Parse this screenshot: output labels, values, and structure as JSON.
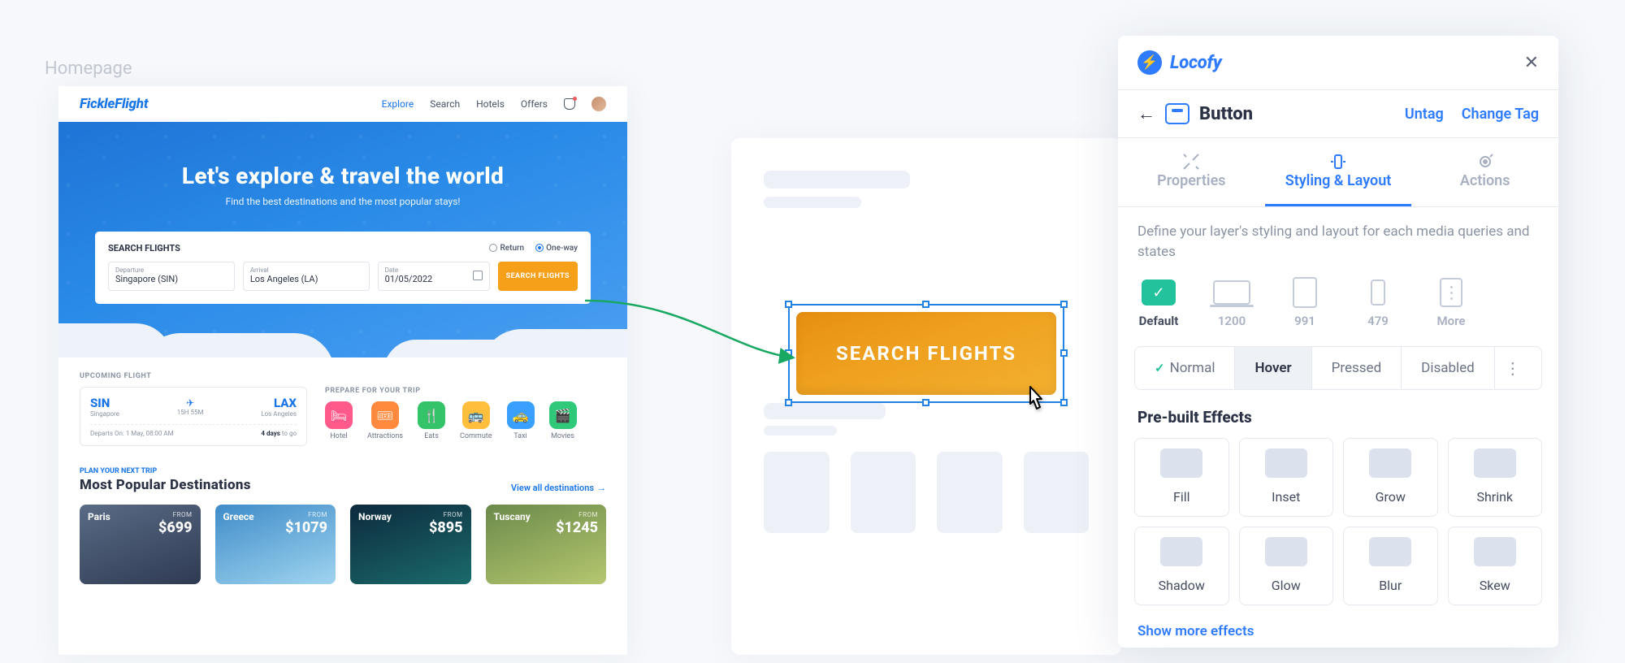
{
  "canvas": {
    "frame_label": "Homepage"
  },
  "homepage": {
    "logo": "FickleFlight",
    "nav": {
      "explore": "Explore",
      "search": "Search",
      "hotels": "Hotels",
      "offers": "Offers"
    },
    "hero": {
      "title": "Let's explore & travel the world",
      "subtitle": "Find the best destinations and the most popular stays!"
    },
    "search_card": {
      "title": "SEARCH FLIGHTS",
      "return_label": "Return",
      "oneway_label": "One-way",
      "departure_label": "Departure",
      "departure_value": "Singapore (SIN)",
      "arrival_label": "Arrival",
      "arrival_value": "Los Angeles (LA)",
      "date_label": "Date",
      "date_value": "01/05/2022",
      "button": "SEARCH FLIGHTS"
    },
    "upcoming": {
      "label": "UPCOMING FLIGHT",
      "from_code": "SIN",
      "from_city": "Singapore",
      "to_code": "LAX",
      "to_city": "Los Angeles",
      "duration": "15H 55M",
      "depart_text": "Departs On: 1 May, 08:00 AM",
      "days_num": "4 days",
      "days_suffix": " to go"
    },
    "prep": {
      "label": "PREPARE FOR YOUR TRIP",
      "items": [
        {
          "name": "Hotel",
          "color": "#ff5a8a",
          "glyph": "🛏"
        },
        {
          "name": "Attractions",
          "color": "#ff8a3d",
          "glyph": "🎟"
        },
        {
          "name": "Eats",
          "color": "#35c36a",
          "glyph": "🍴"
        },
        {
          "name": "Commute",
          "color": "#ffbf3d",
          "glyph": "🚌"
        },
        {
          "name": "Taxi",
          "color": "#39a0ff",
          "glyph": "🚕"
        },
        {
          "name": "Movies",
          "color": "#30c97a",
          "glyph": "🎬"
        }
      ]
    },
    "destinations": {
      "small": "PLAN YOUR NEXT TRIP",
      "title": "Most Popular Destinations",
      "view_all": "View all destinations",
      "from_label": "FROM",
      "cards": [
        {
          "name": "Paris",
          "price": "$699",
          "bg": "linear-gradient(160deg,#5a6b85,#2e3a52)"
        },
        {
          "name": "Greece",
          "price": "$1079",
          "bg": "linear-gradient(160deg,#3f8cc9,#9fd4ef)"
        },
        {
          "name": "Norway",
          "price": "$895",
          "bg": "linear-gradient(160deg,#0d2a3d,#1a6b6b)"
        },
        {
          "name": "Tuscany",
          "price": "$1245",
          "bg": "linear-gradient(160deg,#6b8a4a,#b5c76f)"
        }
      ]
    }
  },
  "preview_button": {
    "label": "SEARCH FLIGHTS"
  },
  "panel": {
    "brand": "Locofy",
    "element": "Button",
    "untag": "Untag",
    "change_tag": "Change Tag",
    "tabs": {
      "properties": "Properties",
      "styling": "Styling & Layout",
      "actions": "Actions"
    },
    "description": "Define your layer's styling and layout for each media queries and states",
    "breakpoints": {
      "default": "Default",
      "bp1": "1200",
      "bp2": "991",
      "bp3": "479",
      "more": "More"
    },
    "states": {
      "normal": "Normal",
      "hover": "Hover",
      "pressed": "Pressed",
      "disabled": "Disabled"
    },
    "effects_title": "Pre-built Effects",
    "effects": [
      "Fill",
      "Inset",
      "Grow",
      "Shrink",
      "Shadow",
      "Glow",
      "Blur",
      "Skew"
    ],
    "show_more": "Show more effects"
  }
}
